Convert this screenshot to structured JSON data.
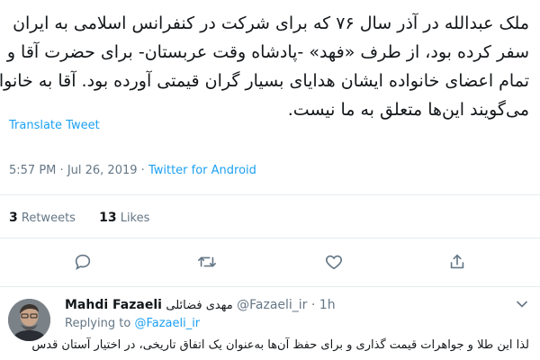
{
  "tweet": {
    "lines": [
      "ملک عبدالله در آذر سال ۷۶ که برای شرکت در کنفرانس اسلامی به ایران",
      "سفر کرده بود، از طرف «فهد» -پادشاه وقت عربستان- برای حضرت آقا و",
      "تمام اعضای خانواده ایشان هدایای بسیار گران قیمتی آورده بود. آقا به خانواده",
      "می‌گویند این‌ها متعلق به ما نیست."
    ],
    "translate_label": "Translate Tweet",
    "time": "5:57 PM",
    "separator": "·",
    "date": "Jul 26, 2019",
    "source": "Twitter for Android"
  },
  "stats": {
    "retweets_count": "3",
    "retweets_label": "Retweets",
    "likes_count": "13",
    "likes_label": "Likes"
  },
  "actions": {
    "icons": [
      "reply-icon",
      "retweet-icon",
      "like-icon",
      "share-icon"
    ]
  },
  "reply": {
    "name": "Mahdi Fazaeli",
    "fa_name": "مهدی فضائلی",
    "handle": "@Fazaeli_ir",
    "dot": "·",
    "time": "1h",
    "replying_prefix": "Replying to",
    "replying_to": "@Fazaeli_ir",
    "text": "لذا این طلا و جواهرات قیمت گذاری و برای حفظ آن‌ها به‌عنوان یک اتفاق تاریخی، در اختیار آستان قدس"
  },
  "colors": {
    "link": "#1da1f2",
    "muted": "#657786",
    "text": "#14171a",
    "divider": "#e6ecf0"
  }
}
